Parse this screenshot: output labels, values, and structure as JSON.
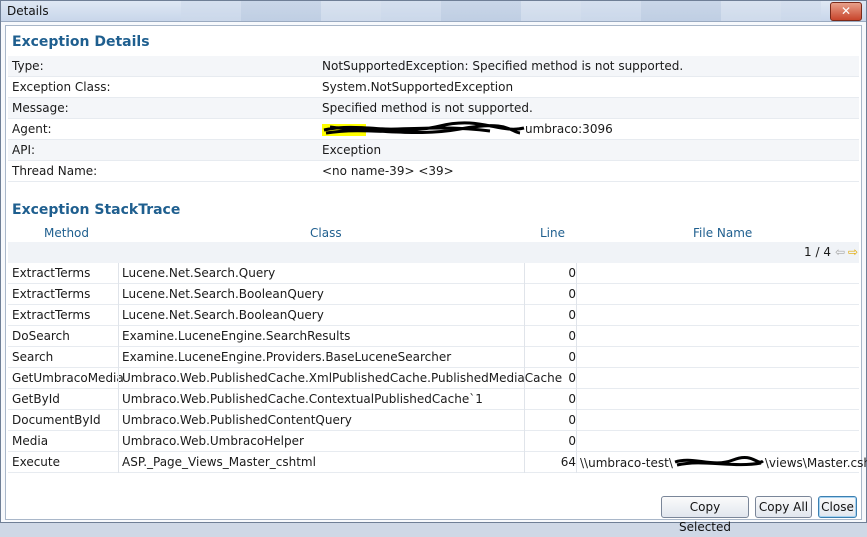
{
  "window": {
    "title": "Details",
    "close_symbol": "✕"
  },
  "details": {
    "heading": "Exception Details",
    "rows": [
      {
        "key": "Type:",
        "value": "NotSupportedException: Specified method is not supported."
      },
      {
        "key": "Exception Class:",
        "value": "System.NotSupportedException"
      },
      {
        "key": "Message:",
        "value": "Specified method is not supported."
      },
      {
        "key": "Agent:",
        "value": "umbraco:3096"
      },
      {
        "key": "API:",
        "value": "Exception"
      },
      {
        "key": "Thread Name:",
        "value": "<no name-39> <39>"
      }
    ]
  },
  "stacktrace": {
    "heading": "Exception StackTrace",
    "columns": {
      "method": "Method",
      "class": "Class",
      "line": "Line",
      "file": "File Name"
    },
    "pager": {
      "text": "1 / 4",
      "prev_icon": "arrow-left-icon",
      "next_icon": "arrow-right-icon"
    },
    "rows": [
      {
        "method": "ExtractTerms",
        "class": "Lucene.Net.Search.Query",
        "line": "0",
        "file": ""
      },
      {
        "method": "ExtractTerms",
        "class": "Lucene.Net.Search.BooleanQuery",
        "line": "0",
        "file": ""
      },
      {
        "method": "ExtractTerms",
        "class": "Lucene.Net.Search.BooleanQuery",
        "line": "0",
        "file": ""
      },
      {
        "method": "DoSearch",
        "class": "Examine.LuceneEngine.SearchResults",
        "line": "0",
        "file": ""
      },
      {
        "method": "Search",
        "class": "Examine.LuceneEngine.Providers.BaseLuceneSearcher",
        "line": "0",
        "file": ""
      },
      {
        "method": "GetUmbracoMedia",
        "class": "Umbraco.Web.PublishedCache.XmlPublishedCache.PublishedMediaCache",
        "line": "0",
        "file": ""
      },
      {
        "method": "GetById",
        "class": "Umbraco.Web.PublishedCache.ContextualPublishedCache`1",
        "line": "0",
        "file": ""
      },
      {
        "method": "DocumentById",
        "class": "Umbraco.Web.PublishedContentQuery",
        "line": "0",
        "file": ""
      },
      {
        "method": "Media",
        "class": "Umbraco.Web.UmbracoHelper",
        "line": "0",
        "file": ""
      },
      {
        "method": "Execute",
        "class": "ASP._Page_Views_Master_cshtml",
        "line": "64",
        "file_start": "\\\\umbraco-test\\",
        "file_end": "\\views\\Master.cshtml"
      }
    ]
  },
  "buttons": {
    "copy_selected": "Copy Selected",
    "copy_all": "Copy All",
    "close": "Close"
  },
  "colors": {
    "accent": "#1f5f8f",
    "highlight": "#ffff00"
  }
}
